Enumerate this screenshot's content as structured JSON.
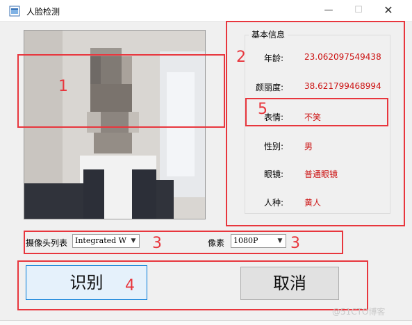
{
  "window": {
    "title": "人脸检测",
    "minimize_glyph": "—",
    "maximize_glyph": "☐",
    "close_glyph": "✕"
  },
  "video": {
    "description_icon": "camera-feed"
  },
  "groupbox": {
    "title": "基本信息",
    "rows": [
      {
        "label": "年龄:",
        "value": "23.062097549438"
      },
      {
        "label": "颜丽度:",
        "value": "38.621799468994"
      },
      {
        "label": "表情:",
        "value": "不笑"
      },
      {
        "label": "性别:",
        "value": "男"
      },
      {
        "label": "眼镜:",
        "value": "普通眼镜"
      },
      {
        "label": "人种:",
        "value": "黄人"
      }
    ]
  },
  "controls": {
    "camera_list_label": "摄像头列表",
    "camera_selected": "Integrated W",
    "pixel_label": "像素",
    "pixel_selected": "1080P"
  },
  "buttons": {
    "recognize": "识别",
    "cancel": "取消"
  },
  "annotations": {
    "n1": "1",
    "n2": "2",
    "n3a": "3",
    "n3b": "3",
    "n4": "4",
    "n5": "5",
    "color": "#e8363d"
  },
  "watermark": "@51CTO博客"
}
